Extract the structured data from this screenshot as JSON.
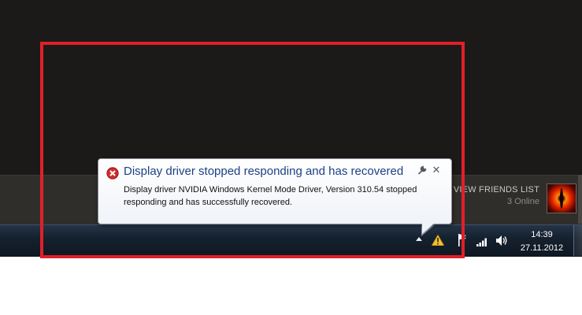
{
  "balloon": {
    "title": "Display driver stopped responding and has recovered",
    "message": "Display driver NVIDIA Windows Kernel Mode Driver, Version 310.54  stopped responding and has successfully recovered.",
    "icons": {
      "status": "error-icon",
      "options": "wrench-icon",
      "close": "close-icon"
    }
  },
  "steam": {
    "friends_label": "VIEW FRIENDS LIST",
    "online_count": "3 Online"
  },
  "taskbar": {
    "tray_icons": [
      "show-hidden-icons-arrow",
      "warning-icon",
      "action-center-flag-icon",
      "network-icon",
      "volume-icon"
    ],
    "clock_time": "14:39",
    "clock_date": "27.11.2012"
  },
  "colors": {
    "highlight_border": "#e0202a",
    "balloon_title": "#1e3f86",
    "taskbar": "#15212e"
  }
}
